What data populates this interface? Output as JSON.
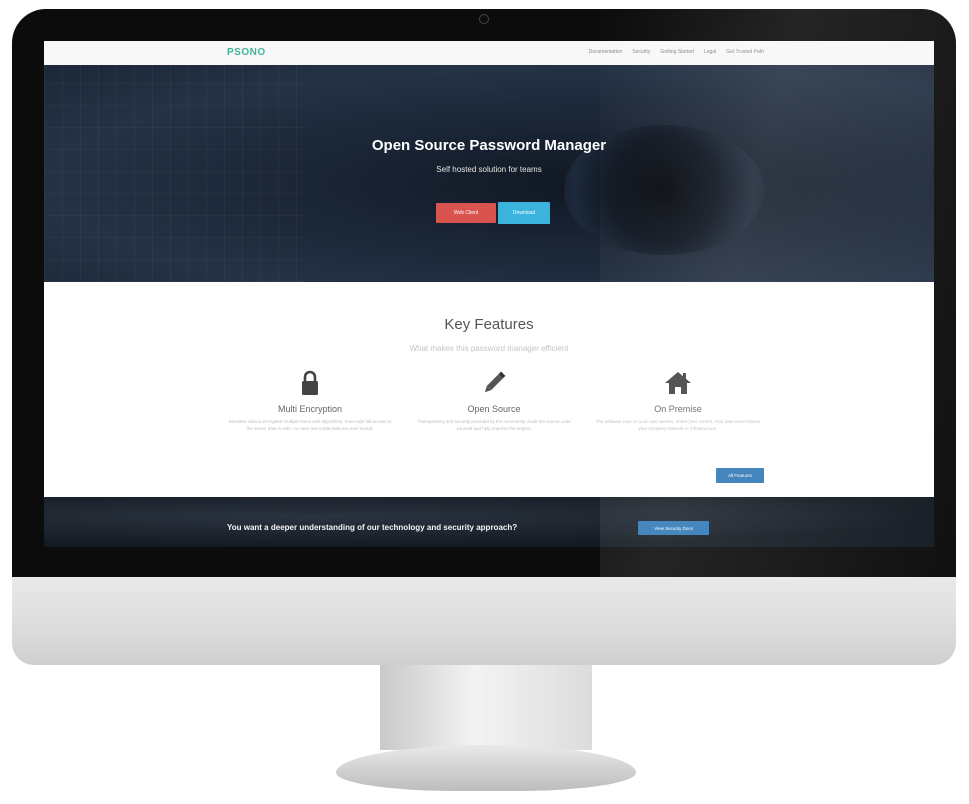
{
  "navbar": {
    "logo": "PSONO",
    "items": [
      "Documentation",
      "Security",
      "Getting Started",
      "Legal",
      "Get Trusted Path"
    ]
  },
  "hero": {
    "title": "Open Source Password Manager",
    "subtitle": "Self hosted solution for teams",
    "demo_button": "Web Client",
    "download_button": "Download"
  },
  "features": {
    "title": "Key Features",
    "subtitle": "What makes this password manager efficient",
    "items": [
      {
        "icon": "lock-icon",
        "name": "Multi Encryption",
        "description": "Sensitive data is encrypted multiple times with algorithms. Even with full access to the server data is safe, no clear text credentials are ever stored."
      },
      {
        "icon": "pencil-icon",
        "name": "Open Source",
        "description": "Transparency and security provided by the community. Audit the source code yourself and help improve the project."
      },
      {
        "icon": "home-icon",
        "name": "On Premise",
        "description": "The software runs on your own servers, under your control. Your data never leaves your company network or infrastructure."
      }
    ],
    "all_button": "All Features"
  },
  "cta": {
    "text": "You want a deeper understanding of our technology and security approach?",
    "button": "View Security Docs"
  },
  "colors": {
    "logo": "#3fb39b",
    "demo_button": "#d9534f",
    "download_button": "#3cb3dc",
    "primary_button": "#337ab7"
  }
}
